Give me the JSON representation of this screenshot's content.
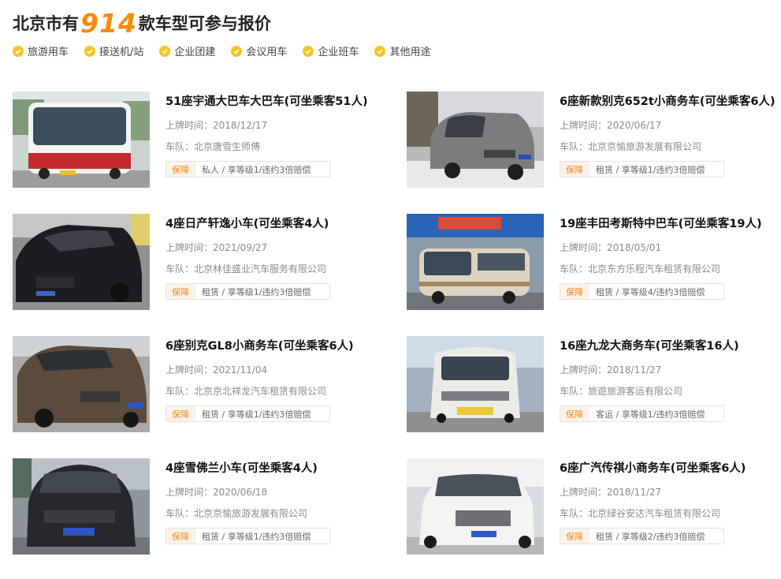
{
  "header": {
    "prefix": "北京市有",
    "count": "914",
    "suffix": "款车型可参与报价"
  },
  "tags": [
    {
      "label": "旅游用车",
      "icon": "check-circle-icon"
    },
    {
      "label": "接送机/站",
      "icon": "check-circle-icon"
    },
    {
      "label": "企业团建",
      "icon": "check-circle-icon"
    },
    {
      "label": "会议用车",
      "icon": "check-circle-icon"
    },
    {
      "label": "企业班车",
      "icon": "check-circle-icon"
    },
    {
      "label": "其他用途",
      "icon": "check-circle-icon"
    }
  ],
  "cars": [
    {
      "title": "51座宇通大巴车大巴车(可坐乘客51人)",
      "date": "上牌时间：2018/12/17",
      "team": "车队：北京唐雪生师傅",
      "badge": "保障",
      "insure": "私人 / 享等级1/违约3倍赔偿",
      "image": "red-white-coach-bus"
    },
    {
      "title": "6座新款别克652t小商务车(可坐乘客6人)",
      "date": "上牌时间：2020/06/17",
      "team": "车队：北京京愉旅游发展有限公司",
      "badge": "保障",
      "insure": "租赁 / 享等级1/违约3倍赔偿",
      "image": "grey-buick-mpv"
    },
    {
      "title": "4座日产轩逸小车(可坐乘客4人)",
      "date": "上牌时间：2021/09/27",
      "team": "车队：北京林佳盛业汽车服务有限公司",
      "badge": "保障",
      "insure": "租赁 / 享等级1/违约3倍赔偿",
      "image": "black-nissan-sedan"
    },
    {
      "title": "19座丰田考斯特中巴车(可坐乘客19人)",
      "date": "上牌时间：2018/05/01",
      "team": "车队：北京东方乐程汽车租赁有限公司",
      "badge": "保障",
      "insure": "租赁 / 享等级4/违约3倍赔偿",
      "image": "beige-toyota-coaster"
    },
    {
      "title": "6座别克GL8小商务车(可坐乘客6人)",
      "date": "上牌时间：2021/11/04",
      "team": "车队：北京京北祥龙汽车租赁有限公司",
      "badge": "保障",
      "insure": "租赁 / 享等级1/违约3倍赔偿",
      "image": "brown-buick-gl8"
    },
    {
      "title": "16座九龙大商务车(可坐乘客16人)",
      "date": "上牌时间：2018/11/27",
      "team": "车队：旅遊旅游客运有限公司",
      "badge": "保障",
      "insure": "客运 / 享等级1/违约3倍赔偿",
      "image": "white-jiulong-van"
    },
    {
      "title": "4座雪佛兰小车(可坐乘客4人)",
      "date": "上牌时间：2020/06/18",
      "team": "车队：北京京愉旅游发展有限公司",
      "badge": "保障",
      "insure": "租赁 / 享等级1/违约3倍赔偿",
      "image": "black-chevrolet-suv"
    },
    {
      "title": "6座广汽传祺小商务车(可坐乘客6人)",
      "date": "上牌时间：2018/11/27",
      "team": "车队：北京绿谷安达汽车租赁有限公司",
      "badge": "保障",
      "insure": "租赁 / 享等级2/违约3倍赔偿",
      "image": "white-gac-mpv"
    }
  ]
}
